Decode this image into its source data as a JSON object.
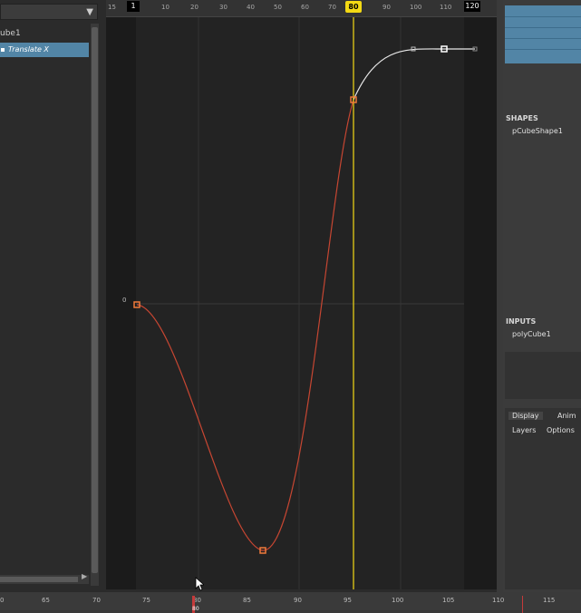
{
  "outliner": {
    "node_label": "ube1",
    "channel_label": "Translate X"
  },
  "ruler": {
    "ticks": [
      "15",
      "10",
      "20",
      "30",
      "40",
      "50",
      "60",
      "70",
      "90",
      "100",
      "110"
    ],
    "start_label": "1",
    "end_label": "120",
    "current_frame": "80"
  },
  "graph": {
    "value_label": "0",
    "curve_color": "#c64632",
    "post_infinity_color": "#e8e8e8",
    "playhead_color": "#f3d914",
    "keys": [
      {
        "frame": 1,
        "value": 0
      },
      {
        "frame": 44,
        "value": -9
      },
      {
        "frame": 80,
        "value": 7.4
      },
      {
        "frame": 110,
        "value": 9.0
      }
    ]
  },
  "attribute_editor": {
    "shapes_heading": "SHAPES",
    "shape_node": "pCubeShape1",
    "inputs_heading": "INPUTS",
    "input_node": "polyCube1",
    "tabs": [
      "Display",
      "Anim"
    ],
    "subtabs": [
      "Layers",
      "Options"
    ]
  },
  "timeline": {
    "ticks": [
      "0",
      "65",
      "70",
      "75",
      "80",
      "85",
      "90",
      "95",
      "100",
      "105",
      "110",
      "115"
    ],
    "current": "80"
  }
}
